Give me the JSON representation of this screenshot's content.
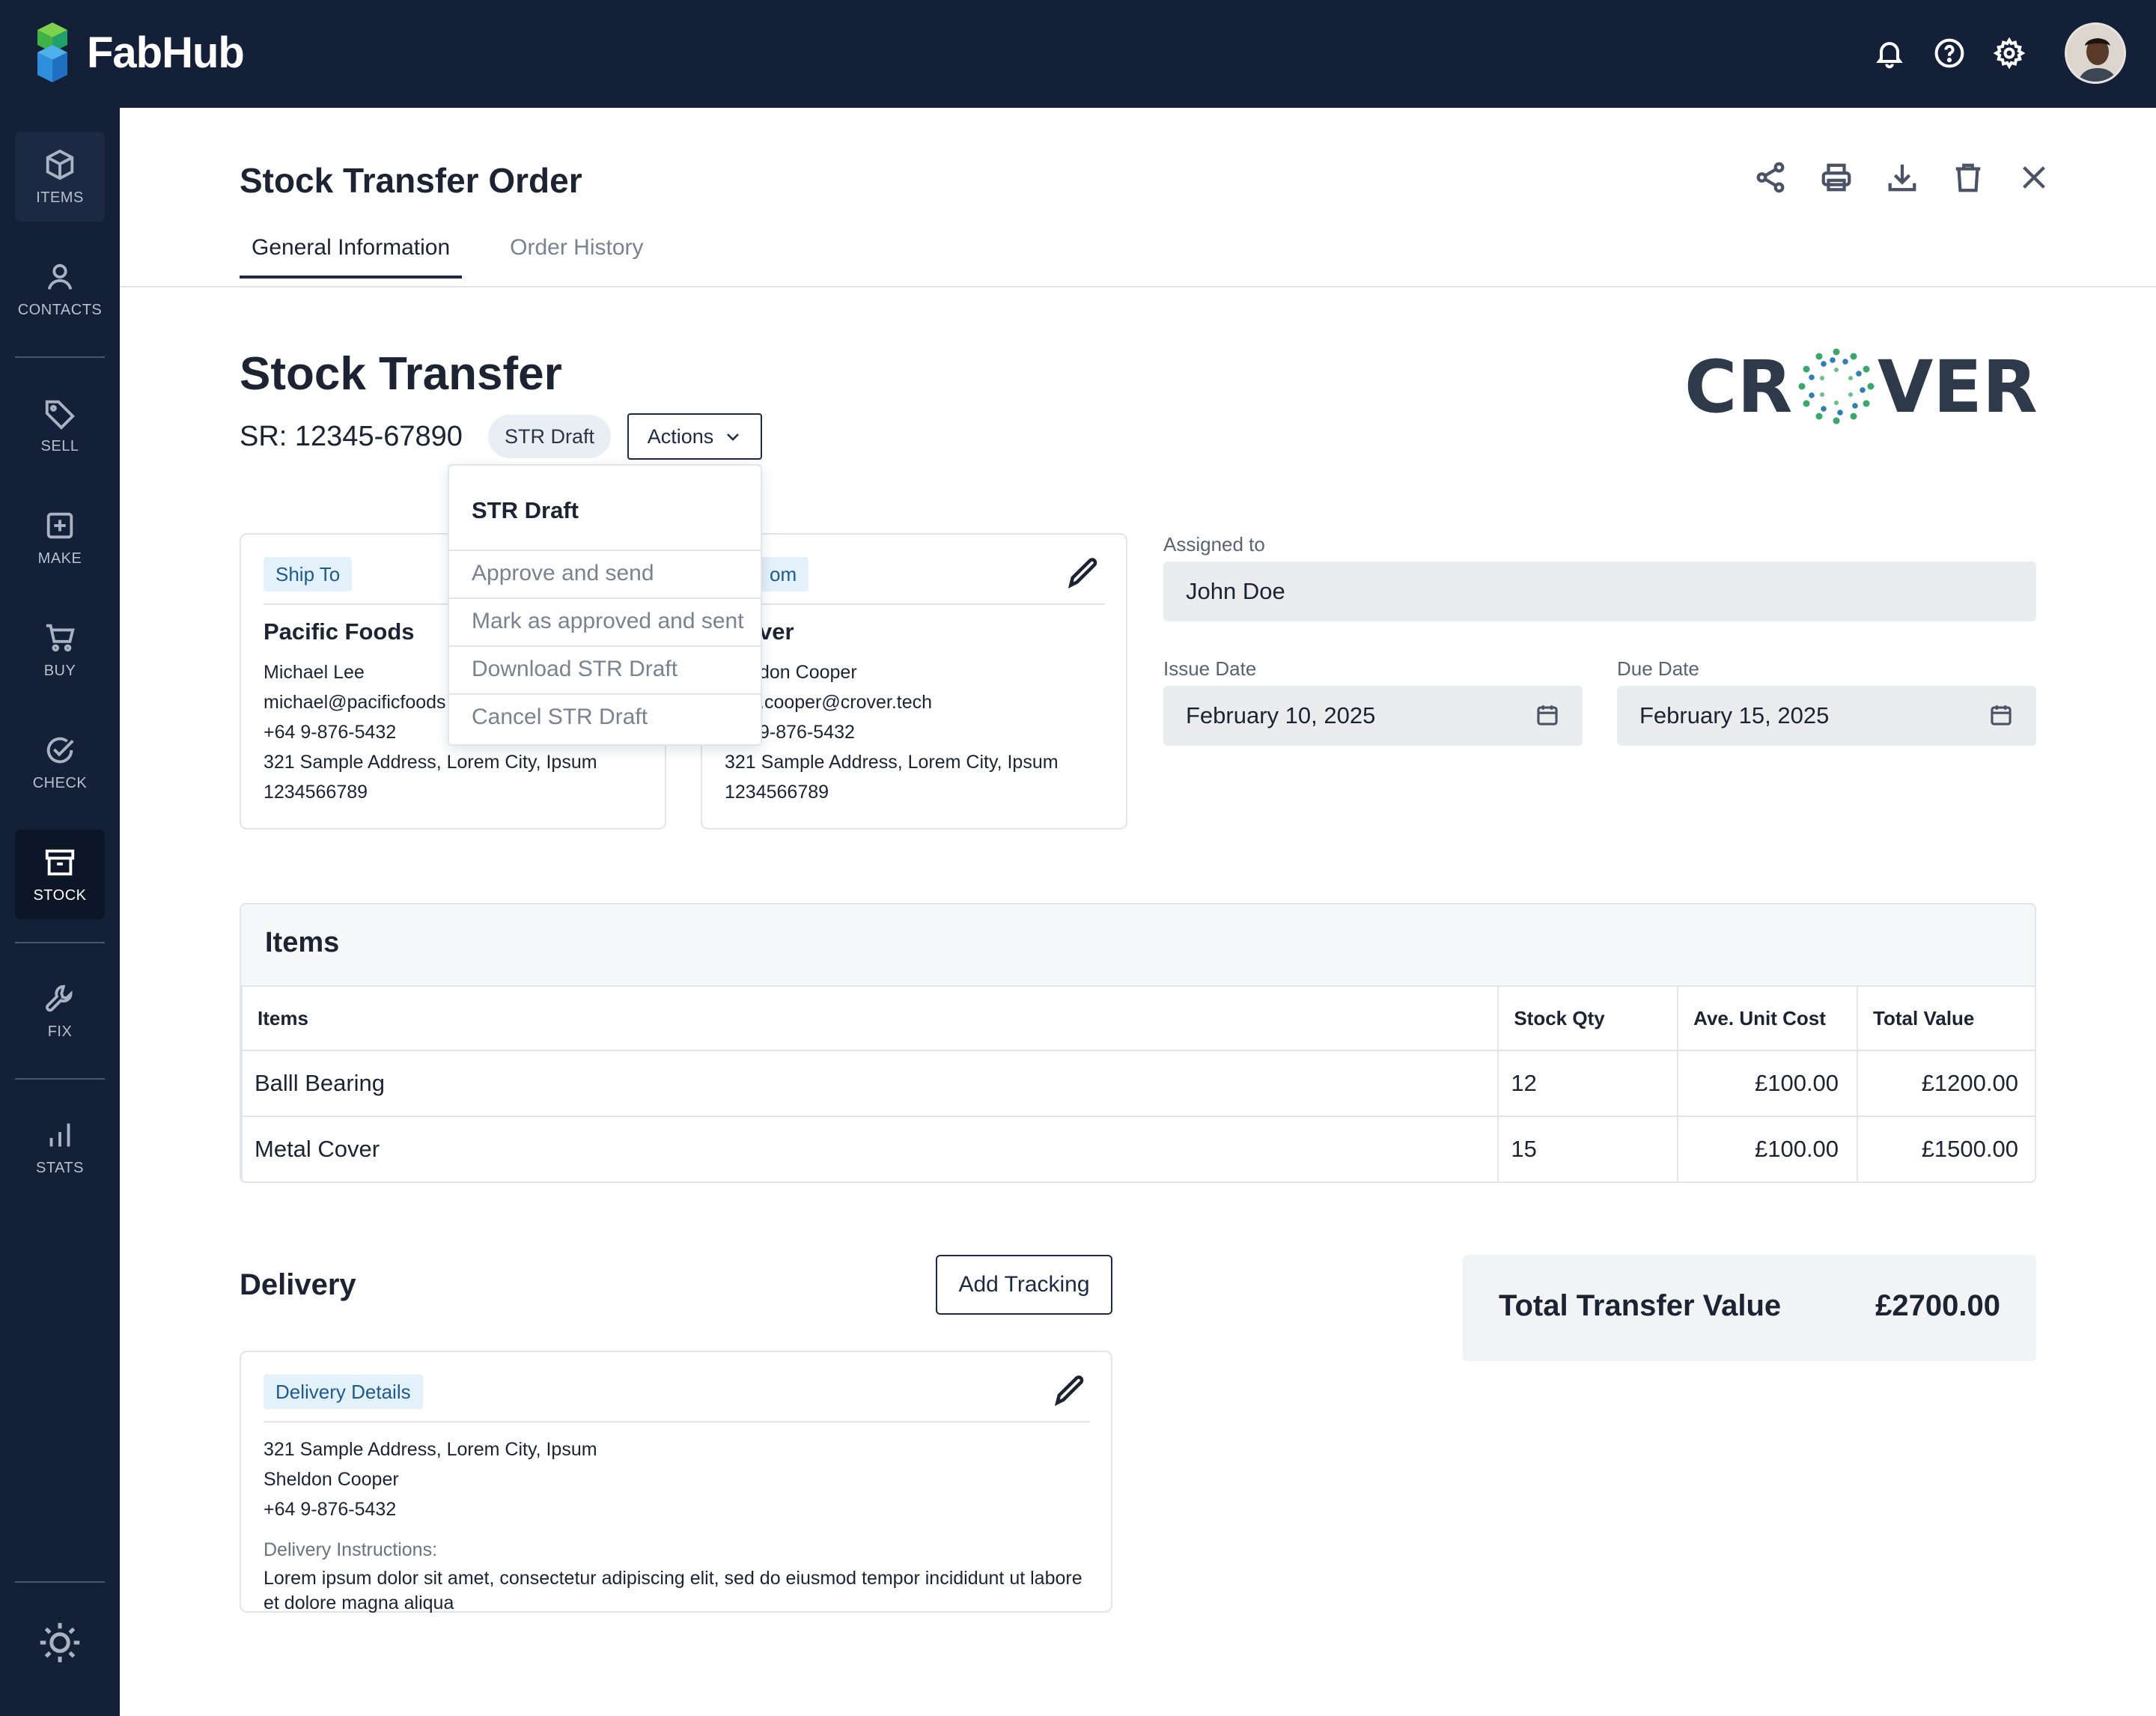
{
  "app": {
    "name": "FabHub"
  },
  "sidebar": {
    "items": [
      {
        "label": "ITEMS"
      },
      {
        "label": "CONTACTS"
      },
      {
        "label": "SELL"
      },
      {
        "label": "MAKE"
      },
      {
        "label": "BUY"
      },
      {
        "label": "CHECK"
      },
      {
        "label": "STOCK"
      },
      {
        "label": "FIX"
      },
      {
        "label": "STATS"
      }
    ]
  },
  "page": {
    "title": "Stock Transfer Order",
    "tabs": [
      {
        "label": "General Information"
      },
      {
        "label": "Order History"
      }
    ]
  },
  "doc": {
    "title": "Stock Transfer",
    "sr": "SR: 12345-67890",
    "status": "STR Draft",
    "actions_label": "Actions",
    "brand": "CROVER"
  },
  "dropdown": {
    "header": "STR Draft",
    "items": [
      {
        "label": "Approve and send"
      },
      {
        "label": "Mark as approved and sent"
      },
      {
        "label": "Download STR Draft"
      },
      {
        "label": "Cancel STR Draft"
      }
    ]
  },
  "ship_to": {
    "tag": "Ship To",
    "name": "Pacific Foods",
    "contact": "Michael Lee",
    "email": "michael@pacificfoods",
    "phone": "+64 9-876-5432",
    "address": "321 Sample Address, Lorem City, Ipsum",
    "code": "1234566789"
  },
  "ship_from": {
    "tag": "om",
    "name": "ver",
    "contact": "don Cooper",
    "email": ".cooper@crover.tech",
    "phone": "9-876-5432",
    "address": "321 Sample Address, Lorem City, Ipsum",
    "code": "1234566789"
  },
  "assigned": {
    "label": "Assigned to",
    "value": "John Doe"
  },
  "issue_date": {
    "label": "Issue Date",
    "value": "February 10, 2025"
  },
  "due_date": {
    "label": "Due Date",
    "value": "February 15, 2025"
  },
  "items": {
    "title": "Items",
    "columns": [
      "Items",
      "Stock Qty",
      "Ave. Unit Cost",
      "Total Value"
    ],
    "rows": [
      {
        "name": "Balll Bearing",
        "qty": "12",
        "unit": "£100.00",
        "total": "£1200.00"
      },
      {
        "name": "Metal Cover",
        "qty": "15",
        "unit": "£100.00",
        "total": "£1500.00"
      }
    ]
  },
  "delivery": {
    "title": "Delivery",
    "add_tracking": "Add Tracking",
    "tag": "Delivery Details",
    "address": "321 Sample Address, Lorem City, Ipsum",
    "contact": "Sheldon Cooper",
    "phone": "+64 9-876-5432",
    "instructions_label": "Delivery Instructions:",
    "instructions": "Lorem ipsum dolor sit amet, consectetur adipiscing elit, sed do eiusmod tempor incididunt ut labore et dolore magna aliqua"
  },
  "total": {
    "label": "Total Transfer Value",
    "value": "£2700.00"
  },
  "colors": {
    "navy": "#142038",
    "accent_tag": "#e3f1fb",
    "brand_dark": "#2e3a4a",
    "brand_green": "#3aa86b",
    "brand_blue": "#2f7fb3"
  }
}
